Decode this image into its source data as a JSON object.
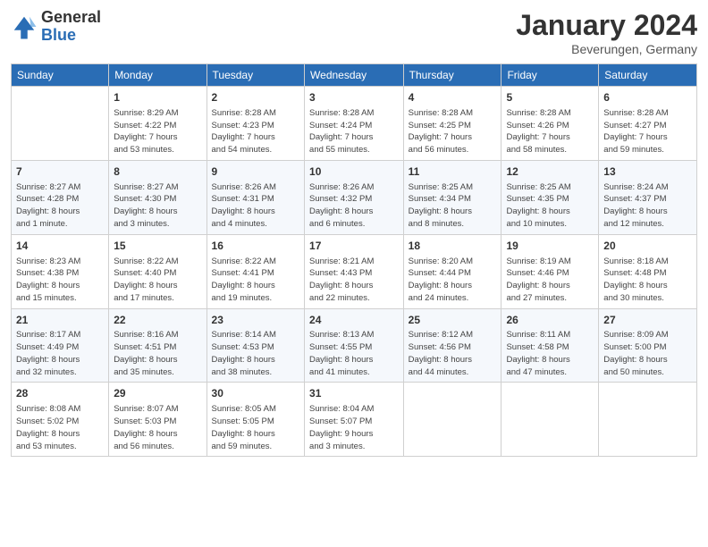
{
  "header": {
    "logo_general": "General",
    "logo_blue": "Blue",
    "month_title": "January 2024",
    "location": "Beverungen, Germany"
  },
  "days_of_week": [
    "Sunday",
    "Monday",
    "Tuesday",
    "Wednesday",
    "Thursday",
    "Friday",
    "Saturday"
  ],
  "weeks": [
    {
      "days": [
        {
          "num": "",
          "info": ""
        },
        {
          "num": "1",
          "info": "Sunrise: 8:29 AM\nSunset: 4:22 PM\nDaylight: 7 hours\nand 53 minutes."
        },
        {
          "num": "2",
          "info": "Sunrise: 8:28 AM\nSunset: 4:23 PM\nDaylight: 7 hours\nand 54 minutes."
        },
        {
          "num": "3",
          "info": "Sunrise: 8:28 AM\nSunset: 4:24 PM\nDaylight: 7 hours\nand 55 minutes."
        },
        {
          "num": "4",
          "info": "Sunrise: 8:28 AM\nSunset: 4:25 PM\nDaylight: 7 hours\nand 56 minutes."
        },
        {
          "num": "5",
          "info": "Sunrise: 8:28 AM\nSunset: 4:26 PM\nDaylight: 7 hours\nand 58 minutes."
        },
        {
          "num": "6",
          "info": "Sunrise: 8:28 AM\nSunset: 4:27 PM\nDaylight: 7 hours\nand 59 minutes."
        }
      ]
    },
    {
      "days": [
        {
          "num": "7",
          "info": "Sunrise: 8:27 AM\nSunset: 4:28 PM\nDaylight: 8 hours\nand 1 minute."
        },
        {
          "num": "8",
          "info": "Sunrise: 8:27 AM\nSunset: 4:30 PM\nDaylight: 8 hours\nand 3 minutes."
        },
        {
          "num": "9",
          "info": "Sunrise: 8:26 AM\nSunset: 4:31 PM\nDaylight: 8 hours\nand 4 minutes."
        },
        {
          "num": "10",
          "info": "Sunrise: 8:26 AM\nSunset: 4:32 PM\nDaylight: 8 hours\nand 6 minutes."
        },
        {
          "num": "11",
          "info": "Sunrise: 8:25 AM\nSunset: 4:34 PM\nDaylight: 8 hours\nand 8 minutes."
        },
        {
          "num": "12",
          "info": "Sunrise: 8:25 AM\nSunset: 4:35 PM\nDaylight: 8 hours\nand 10 minutes."
        },
        {
          "num": "13",
          "info": "Sunrise: 8:24 AM\nSunset: 4:37 PM\nDaylight: 8 hours\nand 12 minutes."
        }
      ]
    },
    {
      "days": [
        {
          "num": "14",
          "info": "Sunrise: 8:23 AM\nSunset: 4:38 PM\nDaylight: 8 hours\nand 15 minutes."
        },
        {
          "num": "15",
          "info": "Sunrise: 8:22 AM\nSunset: 4:40 PM\nDaylight: 8 hours\nand 17 minutes."
        },
        {
          "num": "16",
          "info": "Sunrise: 8:22 AM\nSunset: 4:41 PM\nDaylight: 8 hours\nand 19 minutes."
        },
        {
          "num": "17",
          "info": "Sunrise: 8:21 AM\nSunset: 4:43 PM\nDaylight: 8 hours\nand 22 minutes."
        },
        {
          "num": "18",
          "info": "Sunrise: 8:20 AM\nSunset: 4:44 PM\nDaylight: 8 hours\nand 24 minutes."
        },
        {
          "num": "19",
          "info": "Sunrise: 8:19 AM\nSunset: 4:46 PM\nDaylight: 8 hours\nand 27 minutes."
        },
        {
          "num": "20",
          "info": "Sunrise: 8:18 AM\nSunset: 4:48 PM\nDaylight: 8 hours\nand 30 minutes."
        }
      ]
    },
    {
      "days": [
        {
          "num": "21",
          "info": "Sunrise: 8:17 AM\nSunset: 4:49 PM\nDaylight: 8 hours\nand 32 minutes."
        },
        {
          "num": "22",
          "info": "Sunrise: 8:16 AM\nSunset: 4:51 PM\nDaylight: 8 hours\nand 35 minutes."
        },
        {
          "num": "23",
          "info": "Sunrise: 8:14 AM\nSunset: 4:53 PM\nDaylight: 8 hours\nand 38 minutes."
        },
        {
          "num": "24",
          "info": "Sunrise: 8:13 AM\nSunset: 4:55 PM\nDaylight: 8 hours\nand 41 minutes."
        },
        {
          "num": "25",
          "info": "Sunrise: 8:12 AM\nSunset: 4:56 PM\nDaylight: 8 hours\nand 44 minutes."
        },
        {
          "num": "26",
          "info": "Sunrise: 8:11 AM\nSunset: 4:58 PM\nDaylight: 8 hours\nand 47 minutes."
        },
        {
          "num": "27",
          "info": "Sunrise: 8:09 AM\nSunset: 5:00 PM\nDaylight: 8 hours\nand 50 minutes."
        }
      ]
    },
    {
      "days": [
        {
          "num": "28",
          "info": "Sunrise: 8:08 AM\nSunset: 5:02 PM\nDaylight: 8 hours\nand 53 minutes."
        },
        {
          "num": "29",
          "info": "Sunrise: 8:07 AM\nSunset: 5:03 PM\nDaylight: 8 hours\nand 56 minutes."
        },
        {
          "num": "30",
          "info": "Sunrise: 8:05 AM\nSunset: 5:05 PM\nDaylight: 8 hours\nand 59 minutes."
        },
        {
          "num": "31",
          "info": "Sunrise: 8:04 AM\nSunset: 5:07 PM\nDaylight: 9 hours\nand 3 minutes."
        },
        {
          "num": "",
          "info": ""
        },
        {
          "num": "",
          "info": ""
        },
        {
          "num": "",
          "info": ""
        }
      ]
    }
  ]
}
